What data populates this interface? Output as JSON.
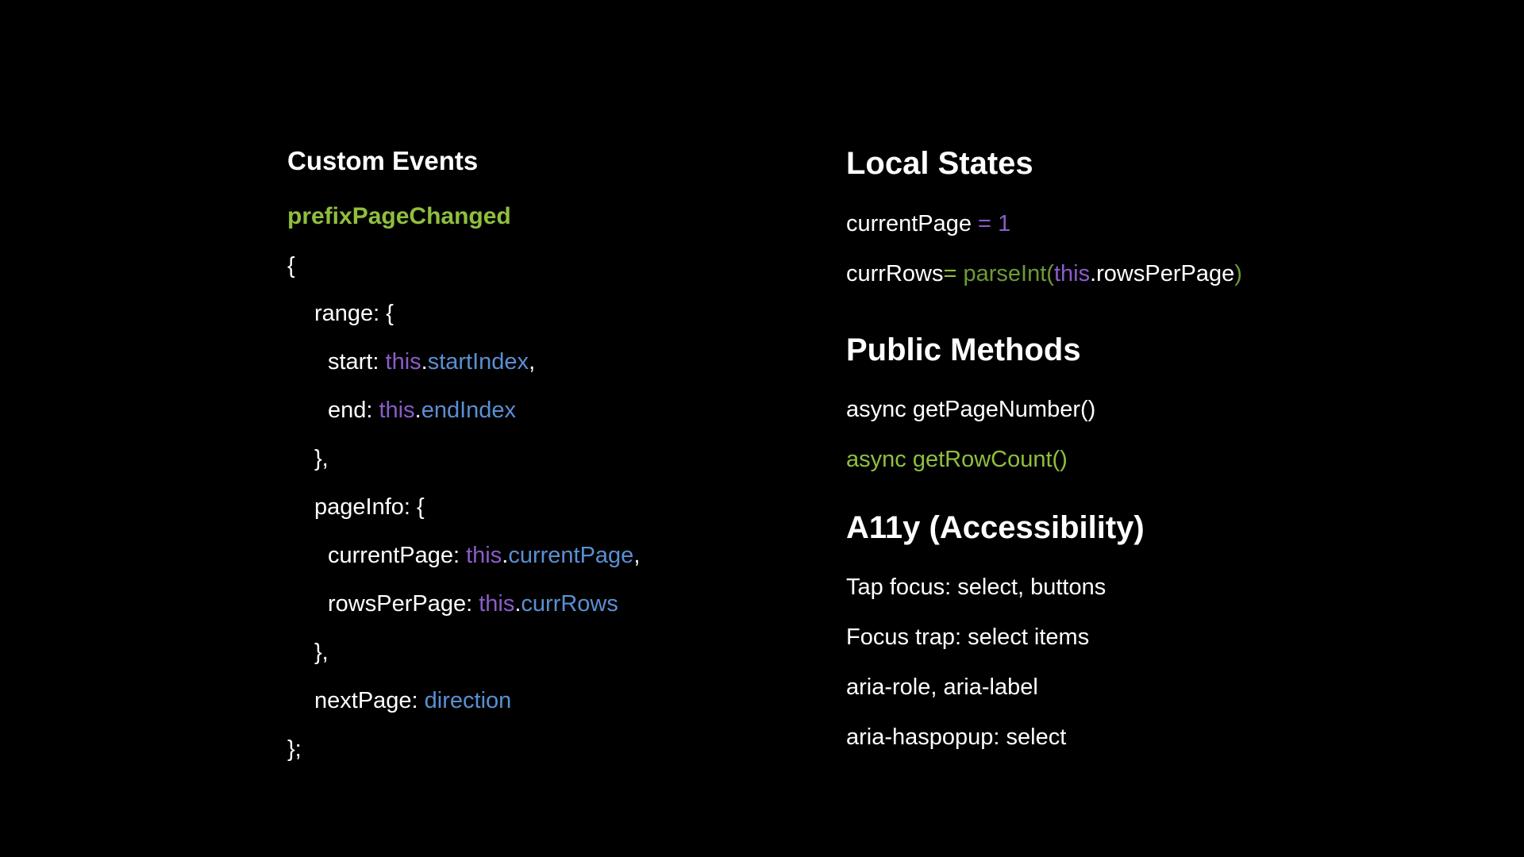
{
  "colors": {
    "background": "#000000",
    "text": "#ffffff",
    "green": "#8fbf3e",
    "purple": "#8a5cc9",
    "blue": "#5b8fd2",
    "dim_green": "#6d9a36"
  },
  "custom_events": {
    "heading": "Custom Events",
    "event_name": "prefixPageChanged",
    "code": {
      "open_brace": "{",
      "range_key": "range: {",
      "start_key": "start: ",
      "start_this": "this",
      "start_dot": ".",
      "start_prop": "startIndex",
      "start_comma": ",",
      "end_key": "end: ",
      "end_this": "this",
      "end_dot": ".",
      "end_prop": "endIndex",
      "range_close": "},",
      "pageinfo_key": "pageInfo: {",
      "currentpage_key": "currentPage: ",
      "currentpage_this": "this",
      "currentpage_dot": ".",
      "currentpage_prop": "currentPage",
      "currentpage_comma": ",",
      "rowsperpage_key": "rowsPerPage: ",
      "rowsperpage_this": "this",
      "rowsperpage_dot": ".",
      "rowsperpage_prop": "currRows",
      "pageinfo_close": "},",
      "nextpage_key": "nextPage: ",
      "nextpage_value": "direction",
      "close_brace": "};"
    }
  },
  "local_states": {
    "heading": "Local States",
    "line1": {
      "name": "currentPage",
      "operator": " = ",
      "value": "1"
    },
    "line2": {
      "name": "currRows",
      "operator": "= ",
      "func": "parseInt",
      "paren_open": "(",
      "this_kw": "this",
      "dot_prop": ".rowsPerPage",
      "paren_close": ")"
    }
  },
  "public_methods": {
    "heading": "Public Methods",
    "items": [
      "async getPageNumber()",
      "async getRowCount()"
    ]
  },
  "a11y": {
    "heading": "A11y (Accessibility)",
    "items": [
      "Tap focus: select, buttons",
      "Focus trap: select items",
      "aria-role, aria-label",
      "aria-haspopup: select"
    ]
  }
}
